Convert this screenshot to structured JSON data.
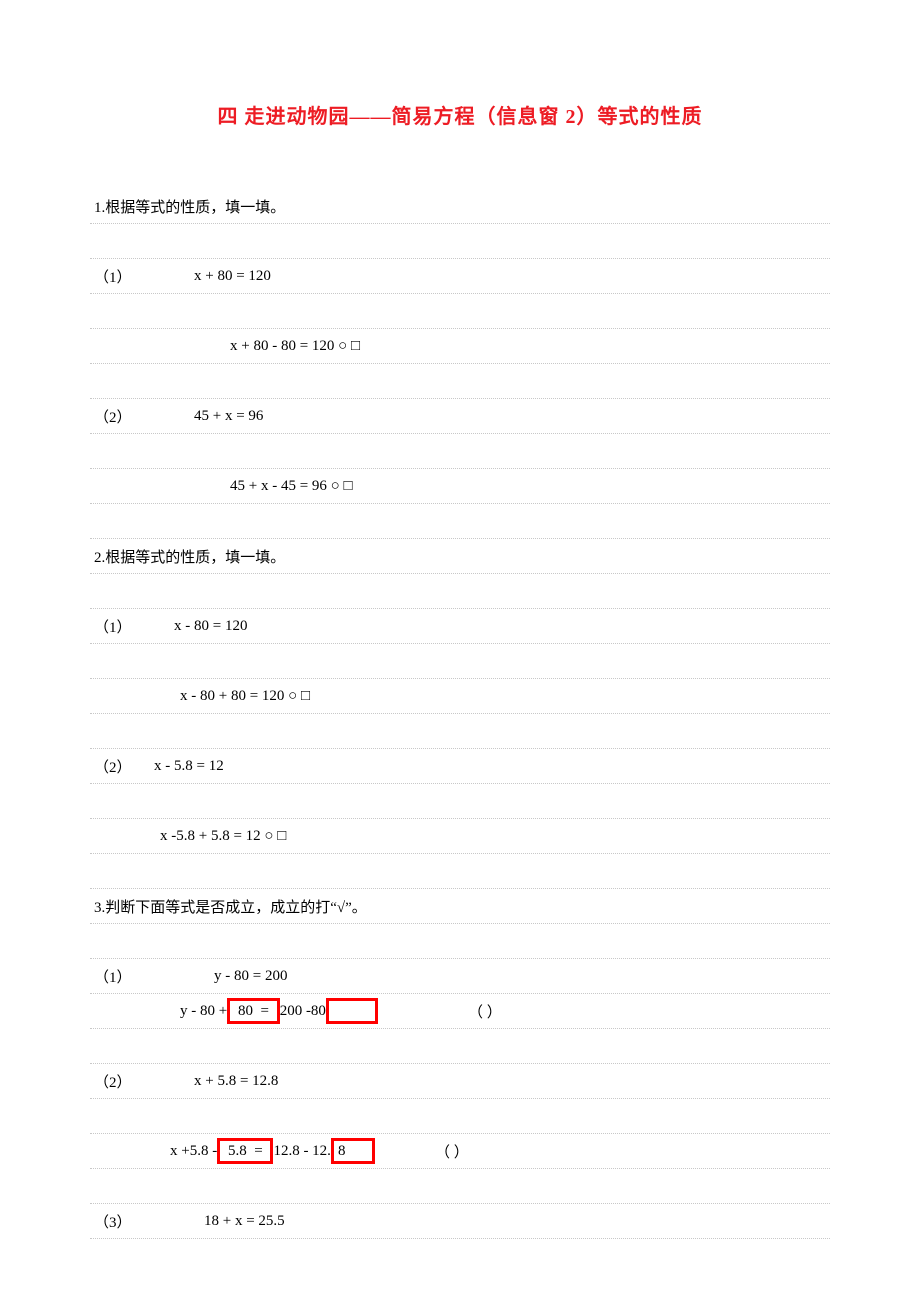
{
  "title": "四 走进动物园——简易方程（信息窗 2）等式的性质",
  "q1": {
    "prompt": "1.根据等式的性质，填一填。",
    "p1_label": "（1）",
    "p1_eq": "x + 80  = 120",
    "p1_step": "x + 80 - 80 = 120 ○ □",
    "p2_label": "（2）",
    "p2_eq": "45 + x  = 96",
    "p2_step": " 45 + x - 45 = 96 ○ □"
  },
  "q2": {
    "prompt": "2.根据等式的性质，填一填。",
    "p1_label": "（1）",
    "p1_eq": "x - 80  = 120",
    "p1_step": "x - 80 + 80  = 120 ○ □",
    "p2_label": "（2）",
    "p2_eq": "x - 5.8   = 12",
    "p2_step": "x -5.8 + 5.8  = 12  ○ □"
  },
  "q3": {
    "prompt": "3.判断下面等式是否成立，成立的打“√”。",
    "p1_label": "（1）",
    "p1_eq": "y - 80  = 200",
    "p1_step_a": "y - 80 +",
    "p1_box1": " 80  = ",
    "p1_step_b": "200 -80",
    "p1_paren": "（       ）",
    "p2_label": "（2）",
    "p2_eq": "x + 5.8   = 12.8",
    "p2_step_a": "x +5.8 -",
    "p2_box1": " 5.8  = ",
    "p2_step_b": "12.8 - 12.",
    "p2_box2": "8      ",
    "p2_paren": "（       ）",
    "p3_label": "（3）",
    "p3_eq": "18  +  x  =  25.5"
  }
}
